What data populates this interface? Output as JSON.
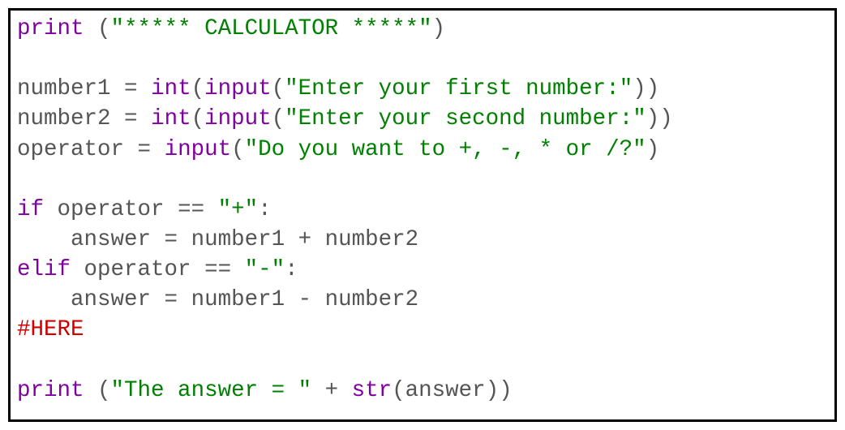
{
  "code": {
    "line1": {
      "print": "print",
      "sp": " ",
      "lp": "(",
      "str": "\"***** CALCULATOR *****\"",
      "rp": ")"
    },
    "line3": {
      "num1": "number1 ",
      "eq": "=",
      "sp": " ",
      "int": "int",
      "lp1": "(",
      "input": "input",
      "lp2": "(",
      "str": "\"Enter your first number:\"",
      "rp2": ")",
      "rp1": ")"
    },
    "line4": {
      "num2": "number2 ",
      "eq": "=",
      "sp": " ",
      "int": "int",
      "lp1": "(",
      "input": "input",
      "lp2": "(",
      "str": "\"Enter your second number:\"",
      "rp2": ")",
      "rp1": ")"
    },
    "line5": {
      "opvar": "operator ",
      "eq": "=",
      "sp": " ",
      "input": "input",
      "lp": "(",
      "str": "\"Do you want to +, -, * or /?\"",
      "rp": ")"
    },
    "line7": {
      "if": "if",
      "sp": " ",
      "opvar": "operator ",
      "eqeq": "==",
      "sp2": " ",
      "str": "\"+\"",
      "colon": ":"
    },
    "line8": {
      "indent": "    ",
      "ans": "answer ",
      "eq": "=",
      "sp": " ",
      "n1": "number1 ",
      "plus": "+",
      "sp2": " ",
      "n2": "number2"
    },
    "line9": {
      "elif": "elif",
      "sp": " ",
      "opvar": "operator ",
      "eqeq": "==",
      "sp2": " ",
      "str": "\"-\"",
      "colon": ":"
    },
    "line10": {
      "indent": "    ",
      "ans": "answer ",
      "eq": "=",
      "sp": " ",
      "n1": "number1 ",
      "minus": "-",
      "sp2": " ",
      "n2": "number2"
    },
    "line11": {
      "comment": "#HERE"
    },
    "line13": {
      "print": "print",
      "sp": " ",
      "lp": "(",
      "str": "\"The answer = \"",
      "sp2": " ",
      "plus": "+",
      "sp3": " ",
      "strfn": "str",
      "lp2": "(",
      "ans": "answer",
      "rp2": ")",
      "rp": ")"
    }
  }
}
